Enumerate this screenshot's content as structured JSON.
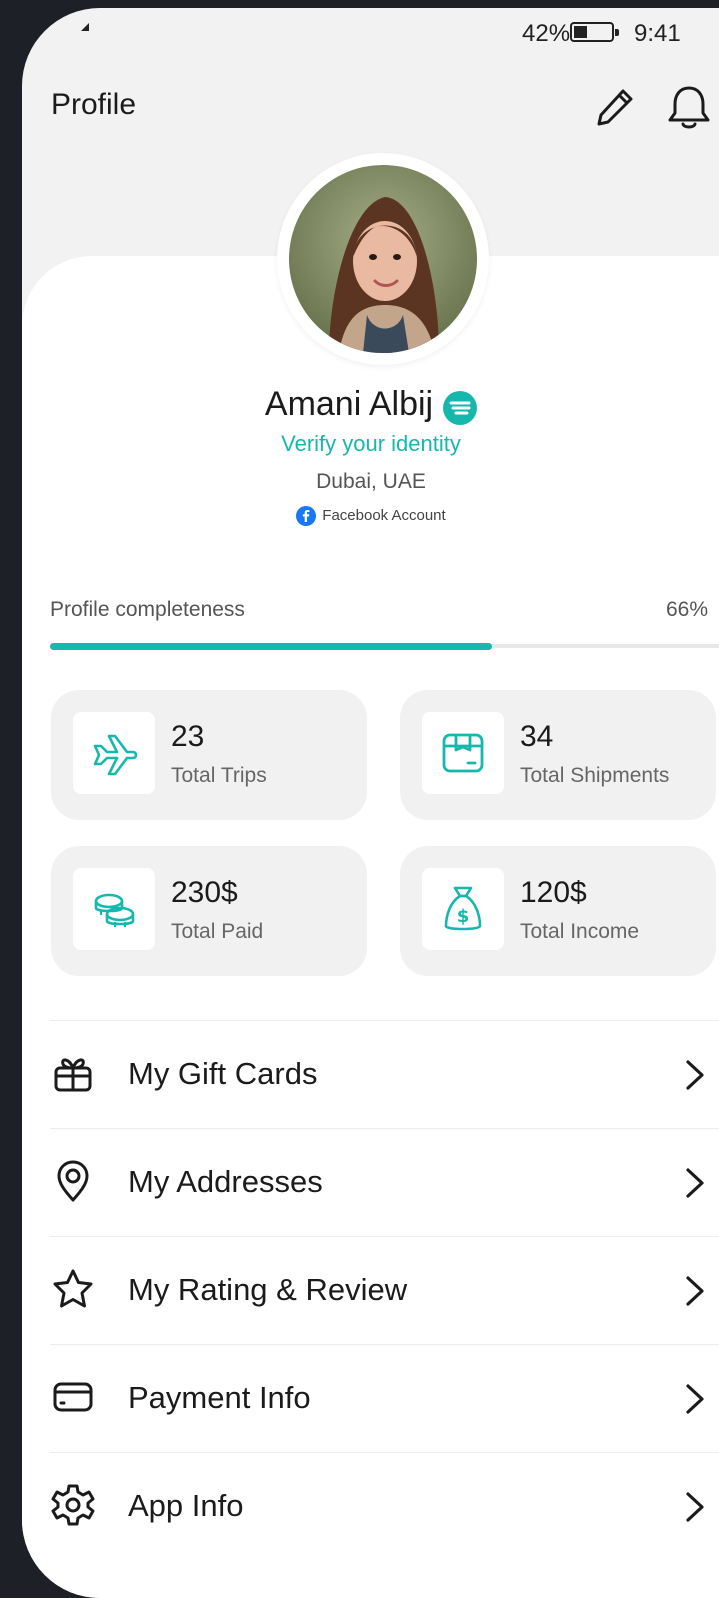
{
  "status_bar": {
    "battery": "42%",
    "battery_level": 0.42,
    "time": "9:41"
  },
  "header": {
    "title": "Profile"
  },
  "user": {
    "name": "Amani Albij",
    "verify_link": "Verify your identity",
    "location": "Dubai, UAE",
    "account_type": "Facebook Account"
  },
  "completeness": {
    "label": "Profile completeness",
    "value_text": "66%",
    "fraction": 0.66
  },
  "stats": [
    {
      "value": "23",
      "label": "Total Trips",
      "icon": "airplane-icon"
    },
    {
      "value": "34",
      "label": "Total Shipments",
      "icon": "package-icon"
    },
    {
      "value": "230$",
      "label": "Total Paid",
      "icon": "coins-icon"
    },
    {
      "value": "120$",
      "label": "Total Income",
      "icon": "money-bag-icon"
    }
  ],
  "menu": [
    {
      "label": "My Gift Cards",
      "icon": "gift-icon"
    },
    {
      "label": "My Addresses",
      "icon": "location-pin-icon"
    },
    {
      "label": "My Rating & Review",
      "icon": "star-icon"
    },
    {
      "label": "Payment Info",
      "icon": "credit-card-icon"
    },
    {
      "label": "App Info",
      "icon": "gear-icon"
    }
  ],
  "colors": {
    "accent": "#16b8ad",
    "background": "#f2f2f2",
    "card": "#ffffff",
    "frame": "#1d2127"
  }
}
